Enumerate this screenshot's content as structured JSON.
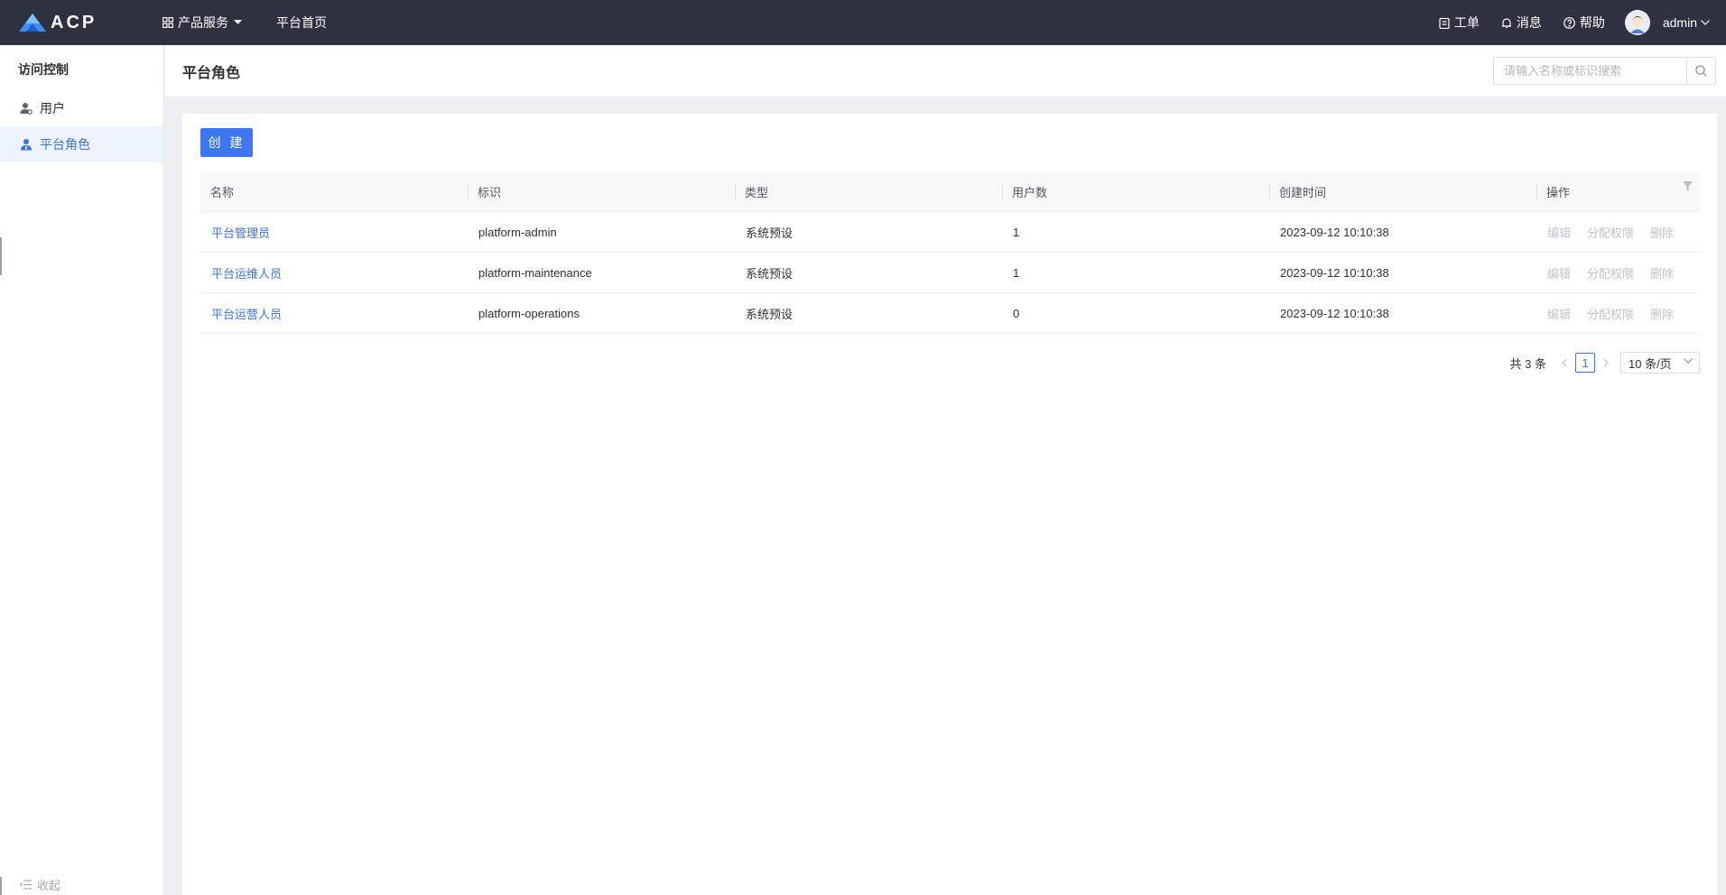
{
  "topbar": {
    "logo_text": "ACP",
    "nav": [
      {
        "label": "产品服务"
      },
      {
        "label": "平台首页"
      }
    ],
    "tools": {
      "ticket": "工单",
      "message": "消息",
      "help": "帮助"
    },
    "user": "admin"
  },
  "sidebar": {
    "title": "访问控制",
    "items": [
      {
        "label": "用户",
        "icon": "user-icon",
        "active": false
      },
      {
        "label": "平台角色",
        "icon": "role-icon",
        "active": true
      }
    ],
    "collapse_label": "收起"
  },
  "header": {
    "title": "平台角色",
    "search_placeholder": "请输入名称或标识搜索"
  },
  "toolbar": {
    "create_label": "创 建"
  },
  "table": {
    "columns": [
      "名称",
      "标识",
      "类型",
      "用户数",
      "创建时间",
      "操作"
    ],
    "rows": [
      {
        "name": "平台管理员",
        "id": "platform-admin",
        "type": "系统预设",
        "users": "1",
        "created": "2023-09-12 10:10:38"
      },
      {
        "name": "平台运维人员",
        "id": "platform-maintenance",
        "type": "系统预设",
        "users": "1",
        "created": "2023-09-12 10:10:38"
      },
      {
        "name": "平台运营人员",
        "id": "platform-operations",
        "type": "系统预设",
        "users": "0",
        "created": "2023-09-12 10:10:38"
      }
    ],
    "actions": {
      "edit": "编辑",
      "assign": "分配权限",
      "delete": "删除"
    }
  },
  "pagination": {
    "total": "共 3 条",
    "current": "1",
    "page_size": "10 条/页"
  },
  "colors": {
    "topbar_bg": "#2e3240",
    "primary": "#3d77f0",
    "link": "#3a73e8",
    "disabled_action": "#c0c4cc"
  }
}
